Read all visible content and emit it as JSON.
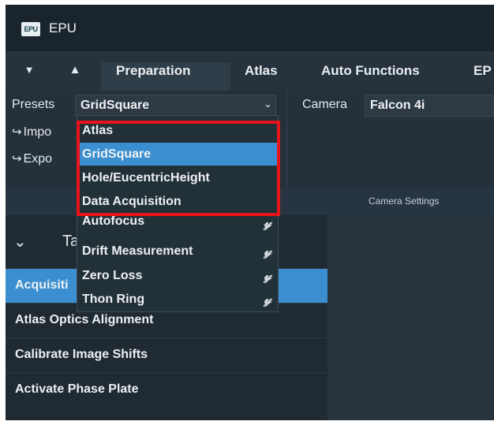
{
  "app": {
    "logo": "EPU",
    "title": "EPU"
  },
  "tabs": {
    "dropdown_icon": "triangle-down-icon",
    "home_icon": "home-icon",
    "items": [
      "Preparation",
      "Atlas",
      "Auto Functions",
      "EP"
    ]
  },
  "presets": {
    "label": "Presets",
    "selected": "GridSquare",
    "import_label": "Impo",
    "export_label": "Expo"
  },
  "camera": {
    "label": "Camera",
    "value": "Falcon 4i",
    "settings_label": "Camera Settings"
  },
  "dropdown": {
    "items": [
      {
        "label": "Atlas",
        "selected": false,
        "linked": false
      },
      {
        "label": "GridSquare",
        "selected": true,
        "linked": false
      },
      {
        "label": "Hole/EucentricHeight",
        "selected": false,
        "linked": false
      },
      {
        "label": "Data Acquisition",
        "selected": false,
        "linked": false
      },
      {
        "label": "Autofocus",
        "selected": false,
        "linked": true
      },
      {
        "label": "Drift Measurement",
        "selected": false,
        "linked": true
      },
      {
        "label": "Zero Loss",
        "selected": false,
        "linked": true
      },
      {
        "label": "Thon Ring",
        "selected": false,
        "linked": true
      }
    ],
    "highlight_color": "#e8141b"
  },
  "tasks": {
    "header": "Ta",
    "rows": [
      {
        "label": "Acquisiti",
        "selected": true
      },
      {
        "label": "Atlas Optics Alignment",
        "selected": false
      },
      {
        "label": "Calibrate Image Shifts",
        "selected": false
      },
      {
        "label": "Activate Phase Plate",
        "selected": false
      }
    ]
  },
  "colors": {
    "accent": "#3b8fd0",
    "background": "#1f2a33"
  }
}
